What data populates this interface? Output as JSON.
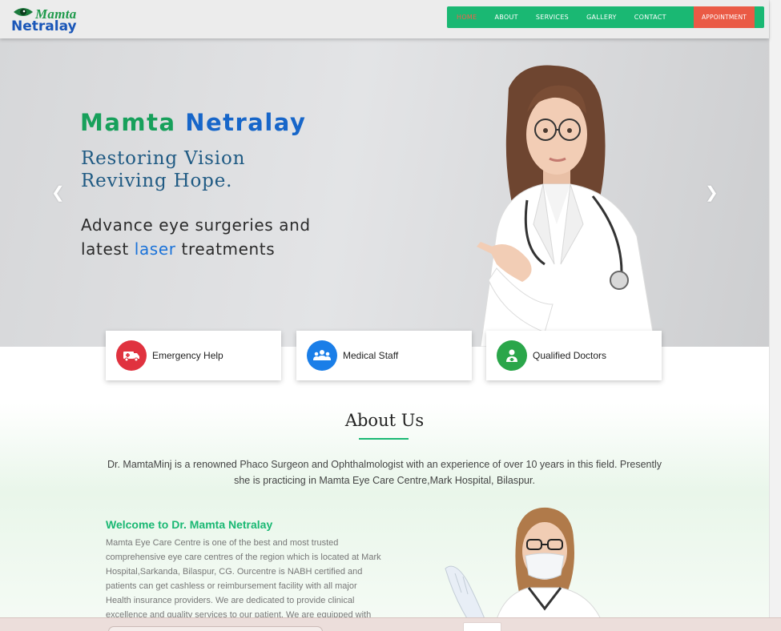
{
  "brand": {
    "logo_top": "Mamta",
    "logo_bottom": "Netralay"
  },
  "nav": {
    "items": [
      {
        "label": "HOME",
        "active": true
      },
      {
        "label": "ABOUT"
      },
      {
        "label": "SERVICES"
      },
      {
        "label": "GALLERY"
      },
      {
        "label": "CONTACT"
      }
    ],
    "appointment_label": "APPOINTMENT",
    "bar_color": "#1ab873",
    "appointment_color": "#ea5a45"
  },
  "hero": {
    "brand_part1": "Mamta",
    "brand_part2": "Netralay",
    "tagline_line1": "Restoring Vision",
    "tagline_line2": "Reviving Hope.",
    "sub_line1": "Advance eye surgeries and",
    "sub_line2_pre": "latest ",
    "sub_line2_highlight": "laser",
    "sub_line2_post": " treatments",
    "prev_icon": "chevron-left-icon",
    "next_icon": "chevron-right-icon"
  },
  "features": [
    {
      "label": "Emergency Help",
      "icon": "ambulance-icon",
      "color": "#e0323f"
    },
    {
      "label": "Medical Staff",
      "icon": "group-icon",
      "color": "#1a7ee8"
    },
    {
      "label": "Qualified Doctors",
      "icon": "doctor-icon",
      "color": "#2aa64a"
    }
  ],
  "about": {
    "title": "About Us",
    "description": "Dr. MamtaMinj is a renowned Phaco Surgeon and Ophthalmologist with an experience of over 10 years in this field. Presently she is practicing in Mamta Eye Care Centre,Mark Hospital, Bilaspur.",
    "welcome_title": "Welcome to Dr. Mamta Netralay",
    "welcome_body": "Mamta Eye Care Centre is one of the best and most trusted comprehensive eye care centres of the region which is located at Mark Hospital,Sarkanda, Bilaspur, CG. Ourcentre is NABH certified and patients can get cashless or reimbursement facility with all major Health insurance providers. We are dedicated to provide clinical excellence and quality services to our patient. We are equipped with"
  }
}
